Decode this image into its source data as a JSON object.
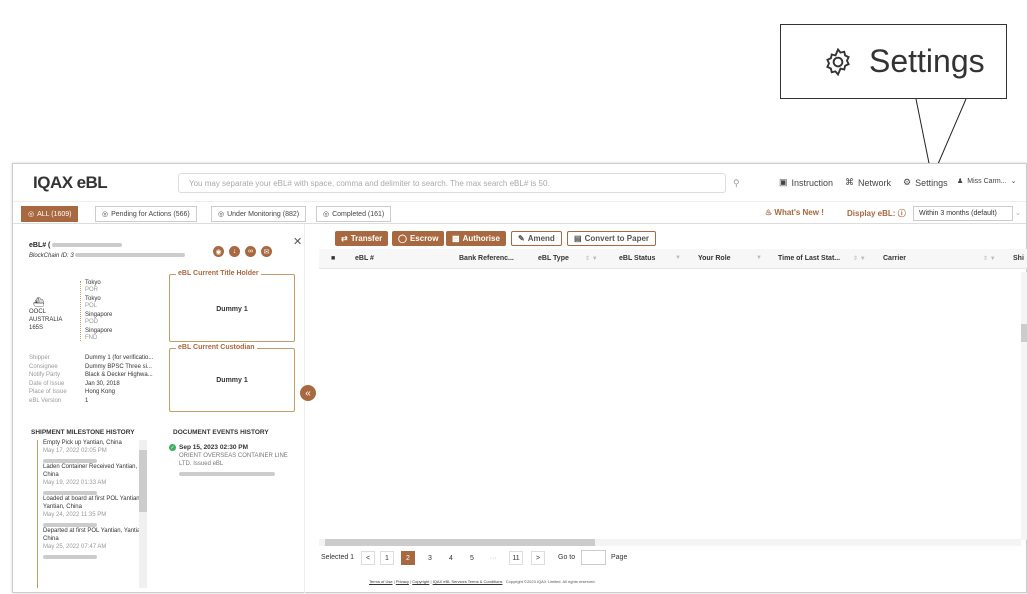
{
  "callout": {
    "label": "Settings",
    "icon": "gear-icon"
  },
  "app": {
    "logo_mark": "IQAX",
    "logo_text": "eBL",
    "search_placeholder": "You may separate your eBL# with space, comma and delimiter to search. The max search eBL# is 50.",
    "nav": {
      "instruction": "Instruction",
      "network": "Network",
      "settings": "Settings",
      "user": "Miss Carm..."
    }
  },
  "tabs": [
    {
      "label": "ALL (1609)"
    },
    {
      "label": "Pending for Actions (566)"
    },
    {
      "label": "Under Monitoring (882)"
    },
    {
      "label": "Completed (161)"
    }
  ],
  "whats_new": "What's New !",
  "display_label": "Display eBL:",
  "display_value": "Within 3 months (default)",
  "detail": {
    "ebl_label": "eBL# (",
    "blockchain_label": "BlockChain ID: 3",
    "route": [
      {
        "place": "Tokyo",
        "code": "POR"
      },
      {
        "place": "Tokyo",
        "code": "POL"
      },
      {
        "place": "Singapore",
        "code": "POD"
      },
      {
        "place": "Singapore",
        "code": "FND"
      }
    ],
    "vessel": [
      "OOCL",
      "AUSTRALIA",
      "165S"
    ],
    "info": [
      {
        "label": "Shipper",
        "value": "Dummy 1 (for verificatio..."
      },
      {
        "label": "Consignee",
        "value": "Dummy BPSC Three si..."
      },
      {
        "label": "Notify Party",
        "value": "Black & Decker Highwa..."
      },
      {
        "label": "Date of Issue",
        "value": "Jan 30, 2018"
      },
      {
        "label": "Place of Issue",
        "value": "Hong Kong"
      },
      {
        "label": "eBL Version",
        "value": "1"
      }
    ],
    "title_holder_label": "eBL Current Title Holder",
    "title_holder_value": "Dummy 1",
    "custodian_label": "eBL Current Custodian",
    "custodian_value": "Dummy 1",
    "milestone_header": "SHIPMENT MILESTONE HISTORY",
    "milestones": [
      {
        "event": "Empty Pick up Yantian, China",
        "time": "May 17, 2022 02:05 PM"
      },
      {
        "event": "Laden Container Received Yantian, China",
        "time": "May 19, 2022 01:33 AM"
      },
      {
        "event": "Loaded at board at first POL Yantian, Yantian, China",
        "time": "May 24, 2022 11:35 PM"
      },
      {
        "event": "Departed at first POL Yantian, Yantian, China",
        "time": "May 25, 2022 07:47 AM"
      }
    ],
    "doc_header": "DOCUMENT EVENTS HISTORY",
    "doc_time": "Sep 15, 2023 02:30 PM",
    "doc_text": "ORIENT OVERSEAS CONTAINER LINE LTD. Issued eBL"
  },
  "actions": {
    "transfer": "Transfer",
    "escrow": "Escrow",
    "authorise": "Authorise",
    "amend": "Amend",
    "convert": "Convert to Paper"
  },
  "columns": [
    "eBL #",
    "Bank Referenc...",
    "eBL Type",
    "eBL Status",
    "Your Role",
    "Time of Last Stat...",
    "Carrier",
    "Shi"
  ],
  "pagination": {
    "selected": "Selected 1",
    "pages": [
      "1",
      "2",
      "3",
      "4",
      "5",
      "···",
      "11"
    ],
    "goto": "Go to",
    "page": "Page"
  },
  "footer": {
    "terms": "Terms of Use",
    "privacy": "Privacy",
    "copyright_link": "Copyright",
    "services": "IQAX eBL Services Terms & Conditions",
    "rights": "Copyright ©2023 IQAX Limited. All rights reserved."
  }
}
